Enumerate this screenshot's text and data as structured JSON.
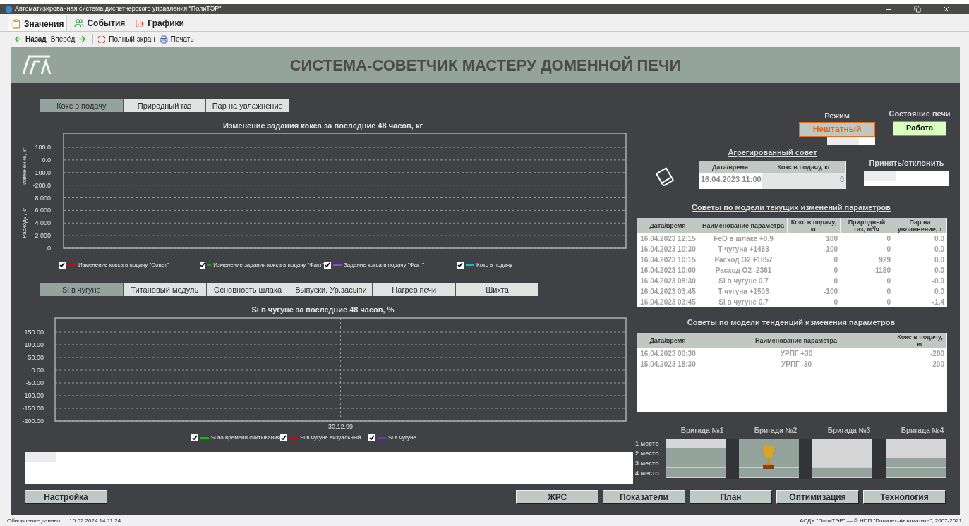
{
  "window": {
    "title": "Автоматизированная система диспетчерского управления \"ПолиТЭР\""
  },
  "menu_tabs": [
    {
      "label": "Значения",
      "kind": "values",
      "selected": true
    },
    {
      "label": "События",
      "kind": "events",
      "selected": false
    },
    {
      "label": "Графики",
      "kind": "charts",
      "selected": false
    }
  ],
  "toolbar": [
    {
      "label": "Назад",
      "kind": "back"
    },
    {
      "label": "Вперёд",
      "kind": "forward"
    },
    {
      "label": "Полный экран",
      "kind": "fullscreen"
    },
    {
      "label": "Печать",
      "kind": "print"
    }
  ],
  "header": {
    "title": "СИСТЕМА-СОВЕТЧИК МАСТЕРУ ДОМЕННОЙ ПЕЧИ"
  },
  "chart_panels": [
    {
      "tabs": [
        {
          "label": "Кокс в подачу",
          "selected": true
        },
        {
          "label": "Природный газ",
          "selected": false
        },
        {
          "label": "Пар на увлажнение",
          "selected": false
        }
      ],
      "chart": {
        "title": "Изменение задания кокса за последние 48 часов, кг",
        "ylabel": "Изменение, кг",
        "y_ticks": [
          "100.0",
          "0.0",
          "-100.0",
          "-200.0"
        ],
        "y2label": "Расходы, кг",
        "y2_ticks": [
          "8 000",
          "6 000",
          "4 000",
          "2 000",
          "0"
        ]
      },
      "legend": [
        {
          "label": "Изменение кокса в подачу \"Совет\"",
          "color": "#e00000",
          "checked": true
        },
        {
          "label": "Изменение задания кокса в подачу \"Факт\"",
          "color": "#00b000",
          "checked": true
        },
        {
          "label": "Задание кокса в подачу \"Факт\"",
          "color": "#9040ff",
          "checked": true
        },
        {
          "label": "Кокс в подачу",
          "color": "#00c8c8",
          "checked": true
        }
      ]
    },
    {
      "tabs": [
        {
          "label": "Si в чугуне",
          "selected": true
        },
        {
          "label": "Титановый модуль",
          "selected": false
        },
        {
          "label": "Основность шлака",
          "selected": false
        },
        {
          "label": "Выпуски. Ур.засыпи",
          "selected": false
        },
        {
          "label": "Нагрев печи",
          "selected": false
        },
        {
          "label": "Шихта",
          "selected": false
        }
      ],
      "chart": {
        "title": "Si в чугуне за последние 48 часов, %",
        "y_ticks": [
          "150.00",
          "100.00",
          "50.00",
          "0.00",
          "-50.00",
          "-100.00",
          "-150.00",
          "-200.00"
        ],
        "x_ticks": [
          "30.12.99"
        ]
      },
      "legend": [
        {
          "label": "Si по времени считывания",
          "color": "#00c800",
          "checked": true
        },
        {
          "label": "Si в чугуне визуальный",
          "color": "#e00000",
          "checked": true
        },
        {
          "label": "Si в чугуне",
          "color": "#7030c0",
          "checked": true
        }
      ]
    }
  ],
  "mode": {
    "label": "Режим",
    "value": "Нештатный"
  },
  "furnace_state": {
    "label": "Состояние печи",
    "value": "Работа"
  },
  "aggregated_advice": {
    "title": "Агрегированный совет",
    "columns": [
      "Дата/время",
      "Кокс в подачу, кг"
    ],
    "rows": [
      [
        "16.04.2023 11:00",
        "0"
      ]
    ]
  },
  "accept_reject": {
    "label": "Принять/отклонить"
  },
  "current_advice": {
    "title": "Советы по модели текущих изменений параметров",
    "columns": [
      "Дата/время",
      "Наименование параметра",
      "Кокс в подачу, кг",
      "Природный газ, м³/ч",
      "Пар на увлажнение, т"
    ],
    "rows": [
      [
        "16.04.2023 12:15",
        "FeO в шлаке +0.9",
        "100",
        "0",
        "0.0"
      ],
      [
        "16.04.2023 10:30",
        "Т чугуна +1483",
        "-100",
        "0",
        "0.0"
      ],
      [
        "16.04.2023 10:15",
        "Расход О2 +1857",
        "0",
        "929",
        "0.0"
      ],
      [
        "16.04.2023 10:00",
        "Расход О2 -2361",
        "0",
        "-1180",
        "0.0"
      ],
      [
        "16.04.2023 08:30",
        "Si в чугуне 0.7",
        "0",
        "0",
        "-0.9"
      ],
      [
        "16.04.2023 03:45",
        "Т чугуна +1503",
        "-100",
        "0",
        "0.0"
      ],
      [
        "16.04.2023 03:45",
        "Si в чугуне 0.7",
        "0",
        "0",
        "-1.4"
      ]
    ]
  },
  "trend_advice": {
    "title": "Советы по модели тенденций изменения параметров",
    "columns": [
      "Дата/время",
      "Наименование параметра",
      "Кокс в подачу, кг"
    ],
    "rows": [
      [
        "16.04.2023 00:30",
        "УРПГ +30",
        "-200"
      ],
      [
        "15.04.2023 18:30",
        "УРПГ -30",
        "200"
      ]
    ]
  },
  "brigades": {
    "places": [
      "1 место",
      "2 место",
      "3 место",
      "4 место"
    ],
    "teams": [
      {
        "name": "Бригада №1",
        "winner": false,
        "cells": [
          {
            "highlighted": true
          },
          {
            "highlighted": false
          },
          {
            "highlighted": false
          },
          {
            "highlighted": false
          }
        ]
      },
      {
        "name": "Бригада №2",
        "winner": true,
        "cells": [
          {
            "highlighted": false
          },
          {
            "highlighted": false
          },
          {
            "highlighted": false
          },
          {
            "highlighted": false
          }
        ]
      },
      {
        "name": "Бригада №3",
        "winner": false,
        "cells": [
          {
            "highlighted": true
          },
          {
            "highlighted": true
          },
          {
            "highlighted": true
          },
          {
            "highlighted": false
          }
        ]
      },
      {
        "name": "Бригада №4",
        "winner": false,
        "cells": [
          {
            "highlighted": true
          },
          {
            "highlighted": true
          },
          {
            "highlighted": false
          },
          {
            "highlighted": false
          }
        ]
      }
    ]
  },
  "buttons_left": [
    "Настройка"
  ],
  "buttons_right": [
    "ЖРС",
    "Показатели",
    "План",
    "Оптимизация",
    "Технология"
  ],
  "status_bar": {
    "label": "Обновление данных:",
    "time": "16.02.2024 14:11:24",
    "copyright": "АСДУ \"ПолиТЭР\" — © НПП \"Политех-Автоматика\", 2007-2021"
  }
}
